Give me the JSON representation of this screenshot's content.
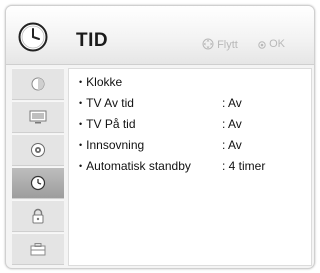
{
  "header": {
    "title": "TID",
    "hint_move": "Flytt",
    "hint_ok": "OK"
  },
  "sidebar": {
    "items": [
      {
        "icon": "picture-icon",
        "active": false
      },
      {
        "icon": "monitor-icon",
        "active": false
      },
      {
        "icon": "sound-icon",
        "active": false
      },
      {
        "icon": "clock-icon",
        "active": true
      },
      {
        "icon": "lock-icon",
        "active": false
      },
      {
        "icon": "toolbox-icon",
        "active": false
      }
    ]
  },
  "menu": {
    "items": [
      {
        "bullet": "•",
        "label": "Klokke",
        "value": ""
      },
      {
        "bullet": "•",
        "label": "TV Av tid",
        "value": ": Av"
      },
      {
        "bullet": "•",
        "label": "TV På tid",
        "value": ": Av"
      },
      {
        "bullet": "•",
        "label": "Innsovning",
        "value": ": Av"
      },
      {
        "bullet": "•",
        "label": "Automatisk standby",
        "value": ": 4 timer"
      }
    ]
  },
  "colors": {
    "panel_bg": "#ffffff",
    "sidebar_bg": "#e4e4e4",
    "active_bg": "#a8a8a8",
    "hint_text": "#b8b8b8"
  }
}
